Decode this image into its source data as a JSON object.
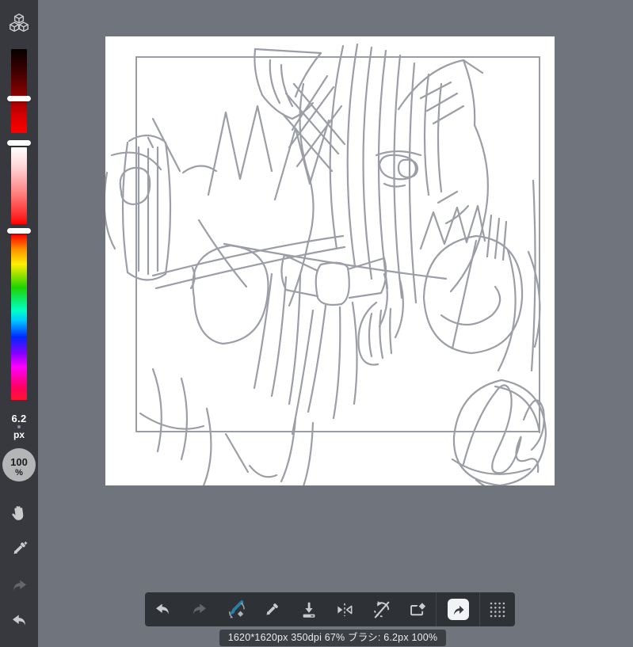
{
  "colors": {
    "bg_main": "#70747d",
    "bg_sidebar": "#37393e",
    "bg_toolbar": "#2e3136",
    "bg_statusbar": "#3b3e43",
    "canvas_bg": "#ffffff",
    "frame_stroke": "#8d939a",
    "sketch_stroke": "#9b9ea6",
    "icon_light": "#c9cbcd",
    "icon_disabled": "#63666b",
    "accent_brush_blue": "#2e7fa8",
    "share_button_bg": "#f2f3f4",
    "zoom_circle_bg": "#b4b5b7",
    "slider_handle": "#ffffff"
  },
  "sidebar": {
    "icons": [
      {
        "name": "blocks-icon"
      },
      {
        "name": "hand-icon"
      },
      {
        "name": "eyedropper-icon"
      },
      {
        "name": "redo-icon"
      },
      {
        "name": "undo-icon"
      }
    ],
    "color_sliders": [
      {
        "name": "value-slider",
        "gradient": "black-to-red"
      },
      {
        "name": "saturation-slider",
        "gradient": "white-to-red"
      },
      {
        "name": "hue-slider",
        "gradient": "rainbow"
      }
    ],
    "brush_size": {
      "value": "6.2",
      "unit": "px"
    },
    "zoom": {
      "value": "100",
      "unit": "%"
    }
  },
  "toolbar": {
    "icons": [
      {
        "name": "undo-icon",
        "enabled": true
      },
      {
        "name": "redo-icon",
        "enabled": false
      },
      {
        "name": "brush-eraser-toggle-icon",
        "enabled": true
      },
      {
        "name": "eyedropper-icon",
        "enabled": true
      },
      {
        "name": "save-icon",
        "enabled": true
      },
      {
        "name": "flip-horizontal-icon",
        "enabled": true
      },
      {
        "name": "rotate-disabled-icon",
        "enabled": true
      },
      {
        "name": "clear-canvas-icon",
        "enabled": true
      },
      {
        "name": "share-icon",
        "enabled": true
      },
      {
        "name": "dock-grid-icon",
        "enabled": true
      }
    ]
  },
  "status_bar": {
    "text": "1620*1620px 350dpi 67% ブラシ: 6.2px 100%"
  }
}
